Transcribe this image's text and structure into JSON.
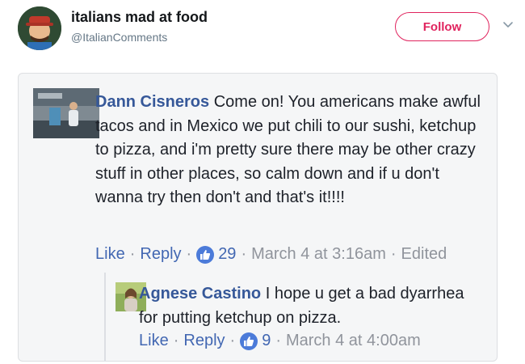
{
  "tweet": {
    "display_name": "italians mad at food",
    "handle": "@ItalianComments",
    "follow_label": "Follow"
  },
  "comment": {
    "author": "Dann Cisneros",
    "text": "Come on! You americans make awful tacos and in Mexico we put chili to our sushi, ketchup to pizza, and i'm pretty sure there may be other crazy stuff in other places, so calm down and if u don't wanna try then don't and that's it!!!!",
    "like_label": "Like",
    "reply_label": "Reply",
    "like_count": "29",
    "timestamp": "March 4 at 3:16am",
    "edited_label": "Edited",
    "separator": "·"
  },
  "reply": {
    "author": "Agnese Castino",
    "text": "I hope u get a bad dyarrhea for putting ketchup on pizza.",
    "like_label": "Like",
    "reply_label": "Reply",
    "like_count": "9",
    "timestamp": "March 4 at 4:00am",
    "separator": "·"
  },
  "colors": {
    "follow_accent": "#e0245e",
    "link_blue": "#365899",
    "like_badge": "#4c7bd9"
  },
  "icons": {
    "caret": "chevron-down-icon",
    "like": "thumbs-up-icon"
  }
}
